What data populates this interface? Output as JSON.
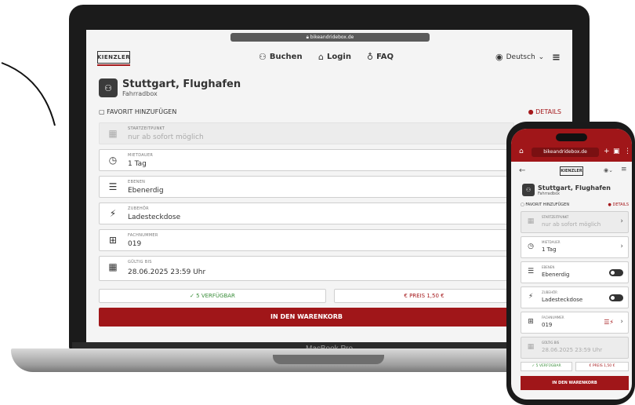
{
  "laptop": {
    "url": "bikeandridebox.de",
    "brand_label": "MacBook Pro",
    "logo_text": "KIENZLER",
    "nav": {
      "buchen": "Buchen",
      "login": "Login",
      "faq": "FAQ",
      "language": "Deutsch"
    },
    "location": {
      "title": "Stuttgart, Flughafen",
      "subtitle": "Fahrradbox"
    },
    "favorite": "FAVORIT HINZUFÜGEN",
    "details": "DETAILS",
    "fields": [
      {
        "label": "STARTZEITPUNKT",
        "value": "nur ab sofort möglich",
        "icon": "calendar-icon"
      },
      {
        "label": "MIETDAUER",
        "value": "1 Tag",
        "icon": "clock-icon"
      },
      {
        "label": "EBENEN",
        "value": "Ebenerdig",
        "icon": "level-icon"
      },
      {
        "label": "ZUBEHÖR",
        "value": "Ladesteckdose",
        "icon": "plug-icon"
      },
      {
        "label": "FACHNUMMER",
        "value": "019",
        "icon": "grid-icon"
      },
      {
        "label": "GÜLTIG BIS",
        "value": "28.06.2025 23:59 Uhr",
        "icon": "calendar-icon"
      }
    ],
    "availability": "5 VERFÜGBAR",
    "price": "PREIS 1,50 €",
    "cart_button": "IN DEN WARENKORB"
  },
  "phone": {
    "url": "bikeandridebox.de",
    "logo_text": "KIENZLER",
    "location": {
      "title": "Stuttgart, Flughafen",
      "subtitle": "Fahrradbox"
    },
    "favorite": "FAVORIT HINZUFÜGEN",
    "details": "DETAILS",
    "fields": [
      {
        "label": "STARTZEITPUNKT",
        "value": "nur ab sofort möglich",
        "icon": "calendar-icon",
        "control": "chevron"
      },
      {
        "label": "MIETDAUER",
        "value": "1 Tag",
        "icon": "clock-icon",
        "control": "chevron"
      },
      {
        "label": "EBENEN",
        "value": "Ebenerdig",
        "icon": "level-icon",
        "control": "toggle"
      },
      {
        "label": "ZUBEHÖR",
        "value": "Ladesteckdose",
        "icon": "plug-icon",
        "control": "toggle"
      },
      {
        "label": "FACHNUMMER",
        "value": "019",
        "icon": "grid-icon",
        "control": "chevron"
      },
      {
        "label": "GÜLTIG BIS",
        "value": "28.06.2025 23:59 Uhr",
        "icon": "calendar-icon",
        "control": "none"
      }
    ],
    "availability": "5 VERFÜGBAR",
    "price": "PREIS 1,50 €",
    "cart_button": "IN DEN WARENKORB"
  },
  "colors": {
    "brand_red": "#a01619",
    "available_green": "#3a8e3a"
  }
}
